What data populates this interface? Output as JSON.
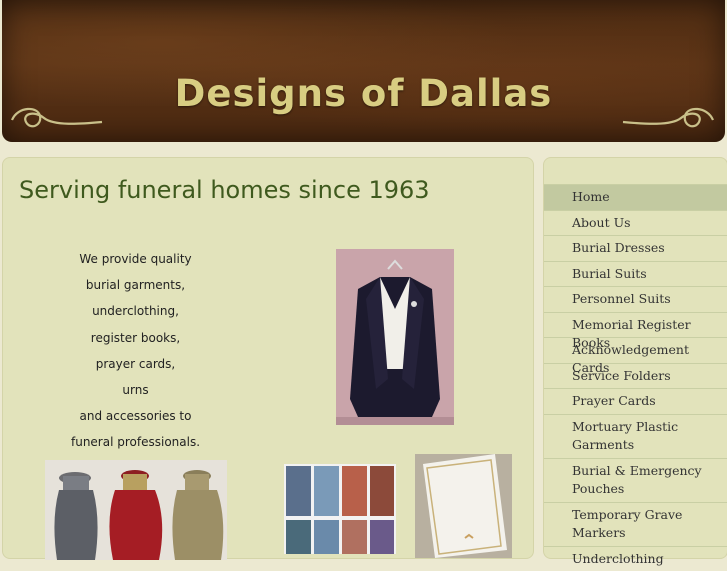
{
  "site": {
    "title": "Designs of Dallas"
  },
  "main": {
    "headline": "Serving funeral homes since 1963",
    "intro_lines": [
      "We provide quality",
      "burial garments,",
      "underclothing,",
      "register books,",
      "prayer cards,",
      "urns",
      "and accessories to",
      "funeral professionals."
    ]
  },
  "nav": {
    "items": [
      {
        "label": "Home"
      },
      {
        "label": "About Us"
      },
      {
        "label": "Burial Dresses"
      },
      {
        "label": "Burial Suits"
      },
      {
        "label": "Personnel Suits"
      },
      {
        "label": "Memorial Register Books"
      },
      {
        "label": "Acknowledgement Cards"
      },
      {
        "label": "Service Folders"
      },
      {
        "label": "Prayer Cards"
      },
      {
        "label": "Mortuary Plastic Garments"
      },
      {
        "label": "Burial & Emergency Pouches"
      },
      {
        "label": "Temporary Grave Markers"
      },
      {
        "label": "Underclothing"
      }
    ],
    "active_index": 0
  },
  "colors": {
    "banner": "#5b3417",
    "title": "#d8cd82",
    "headline": "#3f5a1e",
    "panel": "#e2e3bb",
    "nav_active": "#c2c9a0"
  }
}
